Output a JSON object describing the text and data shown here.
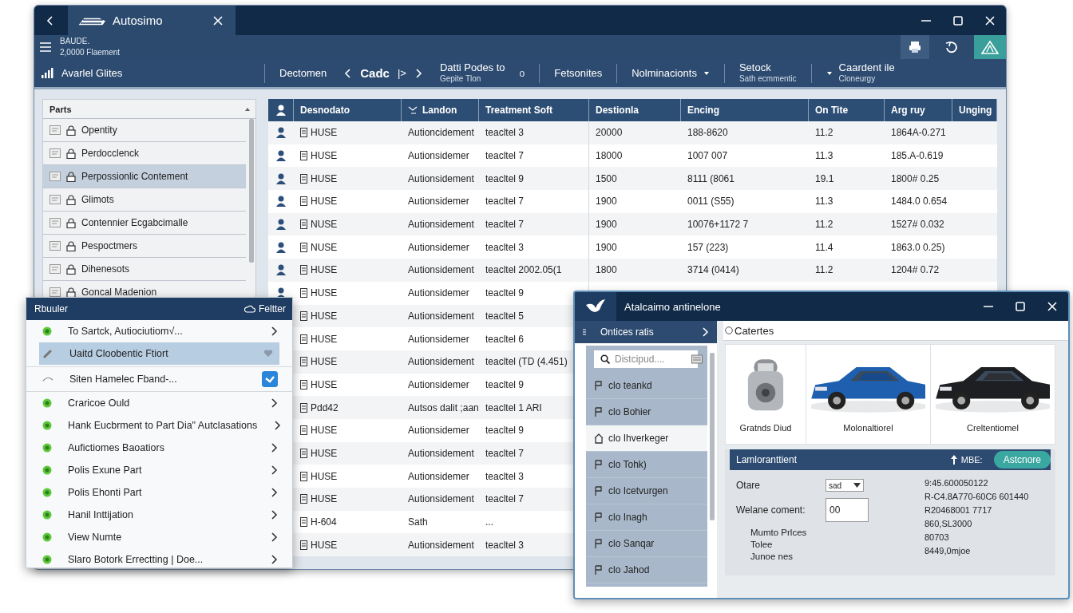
{
  "window": {
    "title": "Autosimo",
    "toolbar_lines": [
      "BAUDE.",
      "2,0000 Flaement"
    ]
  },
  "nav": {
    "left": "Avarlel Glites",
    "groups": [
      [
        {
          "kind": "label",
          "label": "Dectomen"
        },
        {
          "kind": "pager",
          "label": "Cadc",
          "mark": "|>"
        },
        {
          "kind": "two_line",
          "label": "Datti Podes to",
          "sublabel": "Gepite Tlon",
          "trail": "o"
        }
      ],
      [
        {
          "kind": "label",
          "label": "Fetsonites"
        }
      ],
      [
        {
          "kind": "dropdown",
          "label": "Nolminacionts"
        }
      ],
      [
        {
          "kind": "two_line",
          "label": "Setock",
          "sublabel": "Sath ecmmentic"
        }
      ],
      [
        {
          "kind": "lead_dropdown",
          "label": "Caardent ile",
          "sublabel": "Cloneurgy"
        }
      ]
    ]
  },
  "parts_panel": {
    "title": "Parts",
    "items": [
      {
        "label": "Opentity",
        "selected": false
      },
      {
        "label": "Perdocclenck",
        "selected": false
      },
      {
        "label": "Perpossionlic Contement",
        "selected": true
      },
      {
        "label": "Glimots",
        "selected": false
      },
      {
        "label": "Contennier Ecgabcimalle",
        "selected": false
      },
      {
        "label": "Pespoctmers",
        "selected": false
      },
      {
        "label": "Dihenesots",
        "selected": false
      },
      {
        "label": "Goncal Madenion",
        "selected": false
      }
    ]
  },
  "table": {
    "columns": [
      "Desnodato",
      "Landon",
      "Treatment Soft",
      "Destionla",
      "Encing",
      "On Tite",
      "Arg ruy",
      "Unging"
    ],
    "rows": [
      [
        "HUSE",
        "Autioncidement",
        "teacltel 3",
        "20000",
        "188-8620",
        "11.2",
        "1864A-0.271"
      ],
      [
        "HUSE",
        "Autionsidemer",
        "teacltel 7",
        "18000",
        "1007 007",
        "11.3",
        "185.A-0.619"
      ],
      [
        "HUSE",
        "Autionsidement",
        "teacltel 9",
        "1500",
        "8111 (8061",
        "19.1",
        "1800# 0.25"
      ],
      [
        "HUSE",
        "Autionsidemer",
        "teacltel 7",
        "1900",
        "0011 (S55)",
        "11.3",
        "1484.0 0.654"
      ],
      [
        "NUSE",
        "Autionsidement",
        "teacltel 7",
        "1900",
        "10076+1172 7",
        "11.2",
        "1527# 0.032"
      ],
      [
        "NUSE",
        "Autionsidemer",
        "teacltel 3",
        "1900",
        "157 (223)",
        "11.4",
        "1863.0 0.25)"
      ],
      [
        "HUSE",
        "Autionsidement",
        "teacltel 2002.05(1",
        "1800",
        "3714 (0414)",
        "11.2",
        "1204# 0.72"
      ],
      [
        "HUSE",
        "Autionsidemer",
        "teacltel 9"
      ],
      [
        "HUSE",
        "Autionsidement",
        "teacltel 5"
      ],
      [
        "HUSE",
        "Autionsidemer",
        "teacltel 6"
      ],
      [
        "HUSE",
        "Autionsidement",
        "teacltel (TD (4.451)"
      ],
      [
        "HUSE",
        "Autionsidemer",
        "teacltel 9"
      ],
      [
        "Pdd42",
        "Autsos dalit ;aan",
        "teacltel 1 ARI"
      ],
      [
        "HUSE",
        "Autionsidemer",
        "teacltel 9"
      ],
      [
        "HUSE",
        "Autionsidement",
        "teacltel 7"
      ],
      [
        "HUSE",
        "Autionsidemer",
        "teacltel 3"
      ],
      [
        "HUSE",
        "Autionsidement",
        "teacltel 7"
      ],
      [
        "H-604",
        "Sath",
        "..."
      ],
      [
        "HUSE",
        "Autionsidement",
        "teacltel 3"
      ]
    ]
  },
  "menu": {
    "title": "Rbuuler",
    "filter": "Feltter",
    "items": [
      {
        "kind": "item",
        "label": "To Sartck, Autiociutiom√...",
        "selected": false
      },
      {
        "kind": "item",
        "label": "Uaitd Cloobentic Ftiort",
        "selected": true
      },
      {
        "kind": "checkbox",
        "label": "Siten Hamelec Fband-...",
        "checked": true
      },
      {
        "kind": "item",
        "label": "Craricoe Ould",
        "selected": false
      },
      {
        "kind": "item",
        "label": "Hank Eucbrment to Part Dia\" Autclasations",
        "selected": false
      },
      {
        "kind": "item",
        "label": "Aufictiomes Baoatiors",
        "selected": false
      },
      {
        "kind": "item",
        "label": "Polis Exune Part",
        "selected": false
      },
      {
        "kind": "item",
        "label": "Polis Ehonti Part",
        "selected": false
      },
      {
        "kind": "item",
        "label": "Hanil Inttijation",
        "selected": false
      },
      {
        "kind": "item",
        "label": "View Numte",
        "selected": false
      },
      {
        "kind": "item",
        "label": "Slarо Botork Errectting | Doe...",
        "selected": false
      }
    ]
  },
  "dialog": {
    "title": "Atalcaimo antinelone",
    "sidebar": {
      "title": "Ontices ratis",
      "search": {
        "placeholder": "Distcipud...."
      },
      "items": [
        {
          "label": "clo teankd",
          "selected": false
        },
        {
          "label": "clo Bohier",
          "selected": false
        },
        {
          "label": "clo Ihverkeger",
          "selected": true
        },
        {
          "label": "clo Tohk)",
          "selected": false
        },
        {
          "label": "clo Icetvurgen",
          "selected": false
        },
        {
          "label": "clo Inagh",
          "selected": false
        },
        {
          "label": "clo Sanqar",
          "selected": false
        },
        {
          "label": "clo Jahod",
          "selected": false
        }
      ]
    },
    "section_title": "Catertes",
    "cards": [
      {
        "kind": "picture",
        "caption": "Gratnds Diud"
      },
      {
        "kind": "picture",
        "caption": "Molonaltiorel"
      },
      {
        "kind": "picture",
        "caption": "Creltentiomel"
      }
    ],
    "detail": {
      "title": "Lamloranttient",
      "tag": "MBE:",
      "button": "Astcnore",
      "fields": [
        {
          "kind": "select",
          "label": "Otare",
          "value": "sad"
        },
        {
          "kind": "input",
          "label": "Welane coment:",
          "value": "00"
        },
        {
          "kind": "text",
          "label": "Mumto Prlces"
        },
        {
          "kind": "text",
          "label": "Tolee"
        },
        {
          "kind": "text",
          "label": "Junoe nes"
        }
      ],
      "values": [
        "9:45.600050122",
        "R-C4.8A770-60C6 601440",
        "R20468001 7717",
        "860,SL3000",
        "80703",
        "8449,0mjoe"
      ]
    }
  }
}
